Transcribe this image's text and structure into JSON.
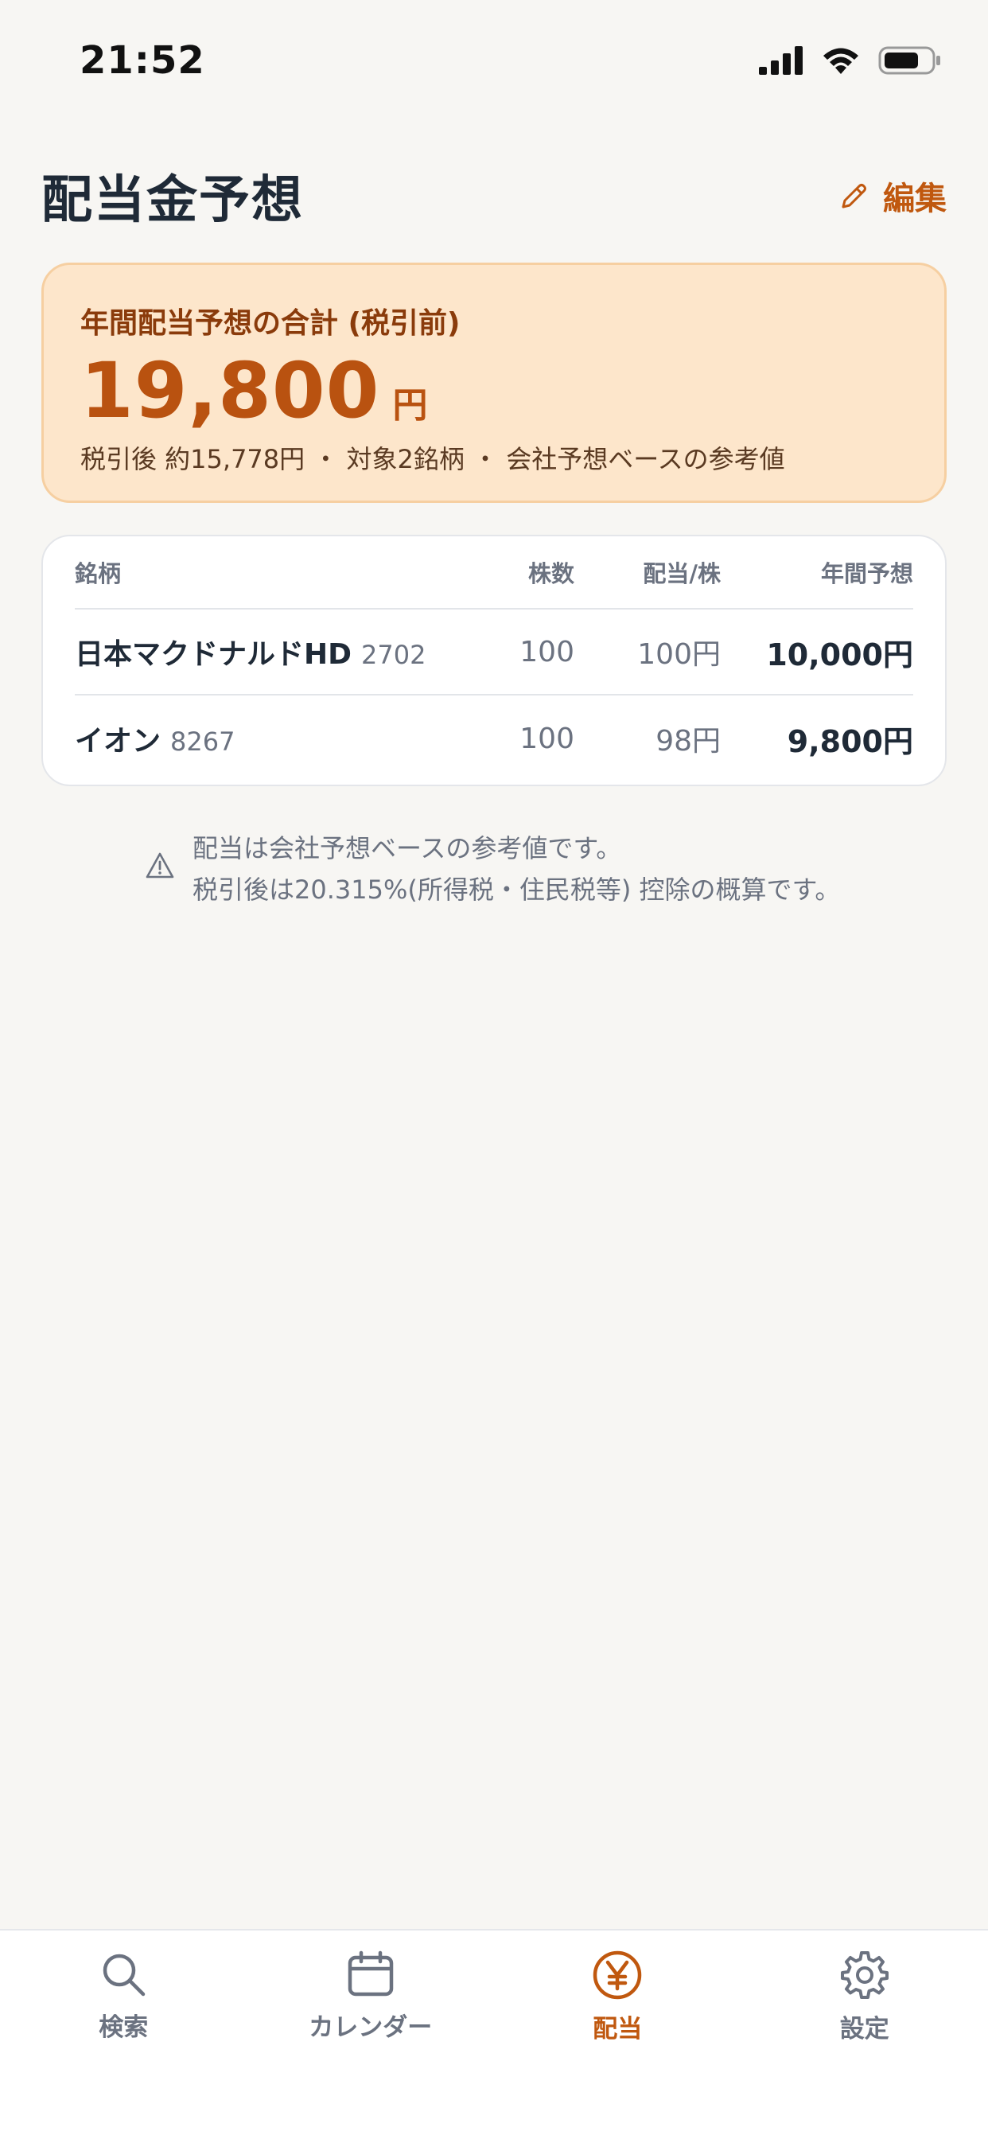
{
  "status_bar": {
    "time": "21:52"
  },
  "header": {
    "title": "配当金予想",
    "edit_label": "編集"
  },
  "summary": {
    "label": "年間配当予想の合計 (税引前)",
    "amount": "19,800",
    "unit": "円",
    "sub": "税引後 約15,778円 ・ 対象2銘柄 ・ 会社予想ベースの参考値"
  },
  "table": {
    "headers": {
      "name": "銘柄",
      "shares": "株数",
      "dividend": "配当/株",
      "annual": "年間予想"
    },
    "rows": [
      {
        "name": "日本マクドナルドHD",
        "code": "2702",
        "shares": "100",
        "dividend": "100円",
        "annual": "10,000円"
      },
      {
        "name": "イオン",
        "code": "8267",
        "shares": "100",
        "dividend": "98円",
        "annual": "9,800円"
      }
    ]
  },
  "note": {
    "line1": "配当は会社予想ベースの参考値です。",
    "line2": "税引後は20.315%(所得税・住民税等) 控除の概算です。"
  },
  "tabs": [
    {
      "label": "検索",
      "icon": "search-icon"
    },
    {
      "label": "カレンダー",
      "icon": "calendar-icon"
    },
    {
      "label": "配当",
      "icon": "yen-icon",
      "active": true
    },
    {
      "label": "設定",
      "icon": "gear-icon"
    }
  ],
  "colors": {
    "accent": "#c0580f",
    "card_bg": "#fde6cb",
    "page_bg": "#f7f6f3"
  }
}
